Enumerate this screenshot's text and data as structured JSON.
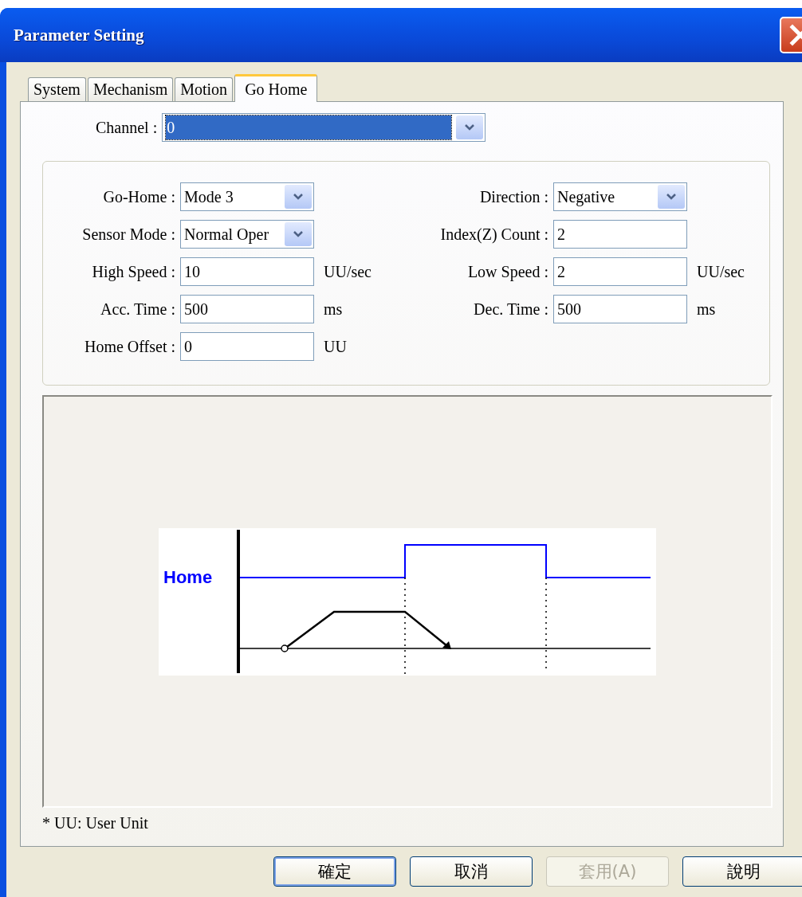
{
  "window": {
    "title": "Parameter Setting"
  },
  "tabs": [
    {
      "label": "System",
      "selected": false
    },
    {
      "label": "Mechanism",
      "selected": false
    },
    {
      "label": "Motion",
      "selected": false
    },
    {
      "label": "Go Home",
      "selected": true
    }
  ],
  "channel": {
    "label": "Channel :",
    "value": "0"
  },
  "left_fields": [
    {
      "kind": "select",
      "label": "Go-Home :",
      "value": "Mode 3"
    },
    {
      "kind": "select",
      "label": "Sensor Mode :",
      "value": "Normal Oper"
    },
    {
      "kind": "text",
      "label": "High Speed :",
      "value": "10",
      "unit": "UU/sec"
    },
    {
      "kind": "text",
      "label": "Acc. Time :",
      "value": "500",
      "unit": "ms"
    },
    {
      "kind": "text",
      "label": "Home Offset :",
      "value": "0",
      "unit": "UU"
    }
  ],
  "right_fields": [
    {
      "kind": "select",
      "label": "Direction :",
      "value": "Negative"
    },
    {
      "kind": "text",
      "label": "Index(Z) Count :",
      "value": "2"
    },
    {
      "kind": "text",
      "label": "Low Speed :",
      "value": "2",
      "unit": "UU/sec"
    },
    {
      "kind": "text",
      "label": "Dec. Time :",
      "value": "500",
      "unit": "ms"
    }
  ],
  "diagram": {
    "signal_label": "Home"
  },
  "footnote": "* UU: User Unit",
  "buttons": [
    {
      "label": "確定",
      "default": true,
      "disabled": false
    },
    {
      "label": "取消",
      "default": false,
      "disabled": false
    },
    {
      "label": "套用(A)",
      "default": false,
      "disabled": true
    },
    {
      "label": "說明",
      "default": false,
      "disabled": false
    }
  ]
}
